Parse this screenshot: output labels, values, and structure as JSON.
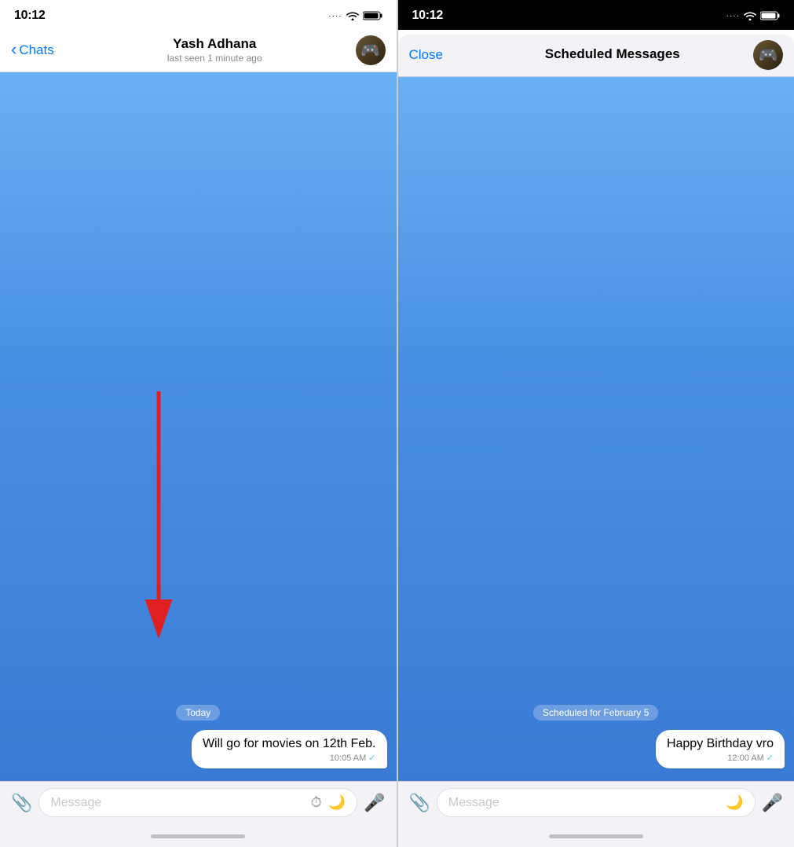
{
  "left_phone": {
    "status_bar": {
      "time": "10:12",
      "dots": "····",
      "wifi": true,
      "battery": true
    },
    "nav": {
      "back_label": "Chats",
      "title": "Yash Adhana",
      "subtitle": "last seen 1 minute ago"
    },
    "chat": {
      "date_badge": "Today",
      "message": {
        "text": "Will go for movies on 12th Feb.",
        "time": "10:05 AM",
        "check": "✓"
      }
    },
    "input_bar": {
      "placeholder": "Message",
      "attach_icon": "📎",
      "scheduled_icon": "⏱",
      "moon_icon": "🌙",
      "mic_icon": "🎤"
    }
  },
  "right_phone": {
    "status_bar": {
      "time": "10:12",
      "dots": "····",
      "wifi": true,
      "battery": true
    },
    "nav": {
      "close_label": "Close",
      "title": "Scheduled Messages"
    },
    "chat": {
      "scheduled_badge": "Scheduled for February 5",
      "message": {
        "text": "Happy Birthday vro",
        "time": "12:00 AM",
        "check": "✓"
      }
    },
    "input_bar": {
      "placeholder": "Message",
      "attach_icon": "📎",
      "moon_icon": "🌙",
      "mic_icon": "🎤"
    }
  }
}
